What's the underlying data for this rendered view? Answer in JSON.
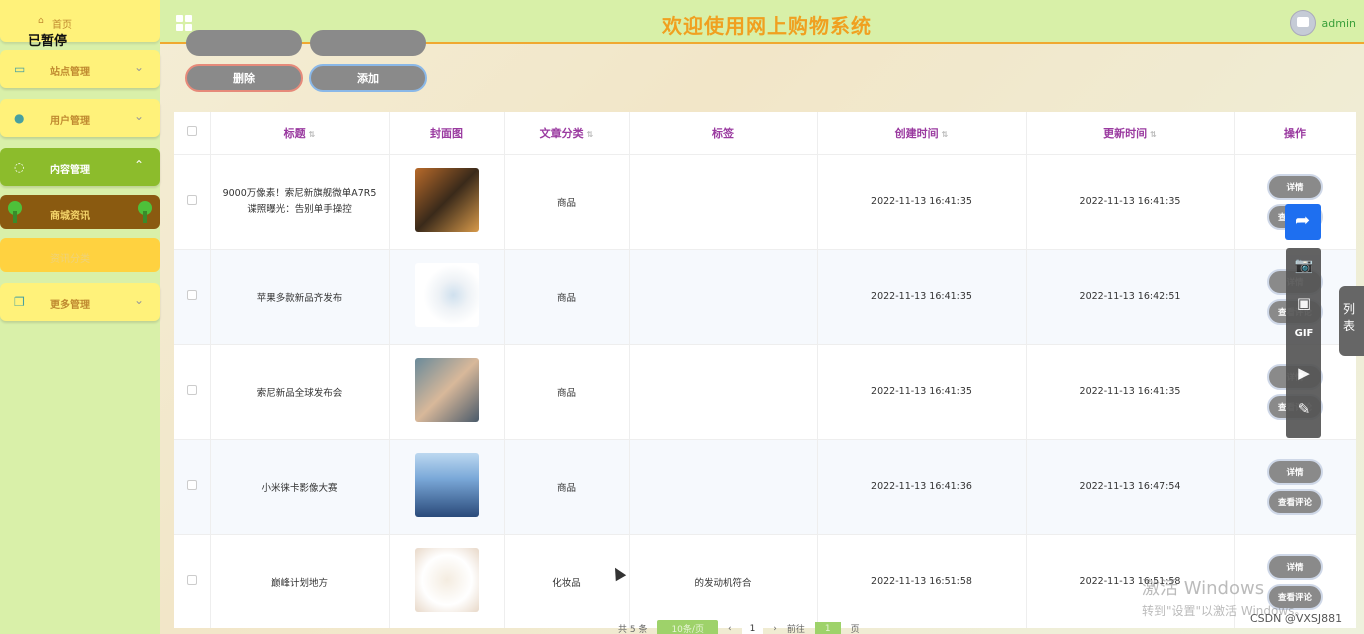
{
  "header": {
    "title": "欢迎使用网上购物系统",
    "username": "admin"
  },
  "sidebar": {
    "home": "首页",
    "overlay": "已暂停",
    "menus": [
      {
        "label": "站点管理",
        "icon": "monitor-icon"
      },
      {
        "label": "用户管理",
        "icon": "user-icon"
      },
      {
        "label": "内容管理",
        "icon": "chat-icon"
      },
      {
        "label": "更多管理",
        "icon": "copy-icon"
      }
    ],
    "sub_items": [
      "商城资讯",
      "资讯分类"
    ]
  },
  "toolbar": {
    "delete_label": "删除",
    "add_label": "添加"
  },
  "table": {
    "columns": [
      "标题",
      "封面图",
      "文章分类",
      "标签",
      "创建时间",
      "更新时间",
      "操作"
    ],
    "rows": [
      {
        "title": "9000万像素！索尼新旗舰微单A7R5谍照曝光：告别单手操控",
        "category": "商品",
        "tag": "",
        "created": "2022-11-13 16:41:35",
        "updated": "2022-11-13 16:41:35"
      },
      {
        "title": "苹果多款新品齐发布",
        "category": "商品",
        "tag": "",
        "created": "2022-11-13 16:41:35",
        "updated": "2022-11-13 16:42:51"
      },
      {
        "title": "索尼新品全球发布会",
        "category": "商品",
        "tag": "",
        "created": "2022-11-13 16:41:35",
        "updated": "2022-11-13 16:41:35"
      },
      {
        "title": "小米徕卡影像大赛",
        "category": "商品",
        "tag": "",
        "created": "2022-11-13 16:41:36",
        "updated": "2022-11-13 16:47:54"
      },
      {
        "title": "巅峰计划地方",
        "category": "化妆品",
        "tag": "的发动机符合",
        "created": "2022-11-13 16:51:58",
        "updated": "2022-11-13 16:51:58"
      }
    ],
    "detail_label": "详情",
    "comment_label": "查看评论"
  },
  "pagination": {
    "total": "共 5 条",
    "page_size": "10条/页",
    "current": "1",
    "goto": "前往",
    "goto_value": "1",
    "page_unit": "页"
  },
  "side_tab": "列表",
  "watermark": {
    "line1": "激活 Windows",
    "line2": "转到\"设置\"以激活 Windows。"
  },
  "csdn": "CSDN @VXSJ881"
}
